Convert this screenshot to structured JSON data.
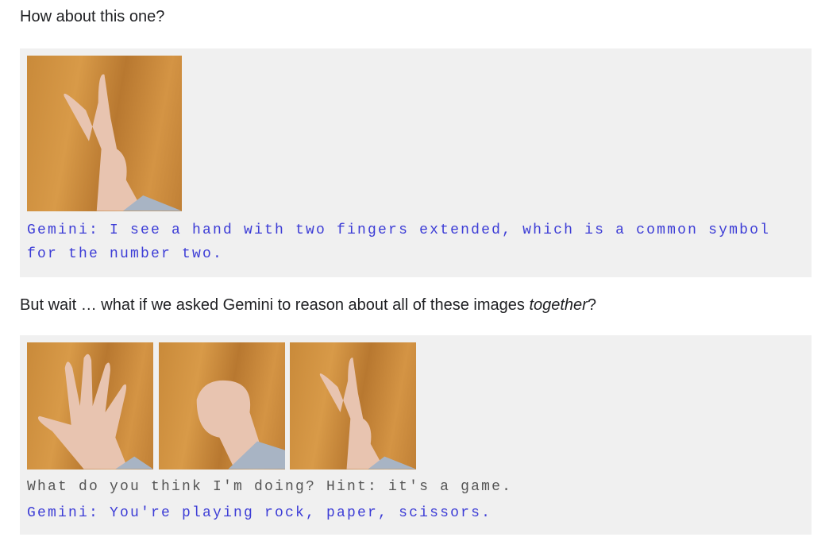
{
  "intro": "How about this one?",
  "block1": {
    "images": [
      {
        "icon": "two-fingers-hand-photo"
      }
    ],
    "lines": [
      "Gemini: I see a hand with two fingers extended, which is a common symbol",
      "for the number two."
    ]
  },
  "middle": {
    "before": "But wait … what if we asked Gemini to reason about all of these images ",
    "emph": "together",
    "after": "?"
  },
  "block2": {
    "images": [
      {
        "icon": "open-hand-photo"
      },
      {
        "icon": "fist-photo"
      },
      {
        "icon": "two-fingers-hand-photo"
      }
    ],
    "prompt": "What do you think I'm doing? Hint: it's a game.",
    "answer": "Gemini: You're playing rock, paper, scissors."
  },
  "colors": {
    "gemini_text": "#3c3cd6",
    "user_text": "#555555",
    "box_bg": "#f0f0f0"
  }
}
